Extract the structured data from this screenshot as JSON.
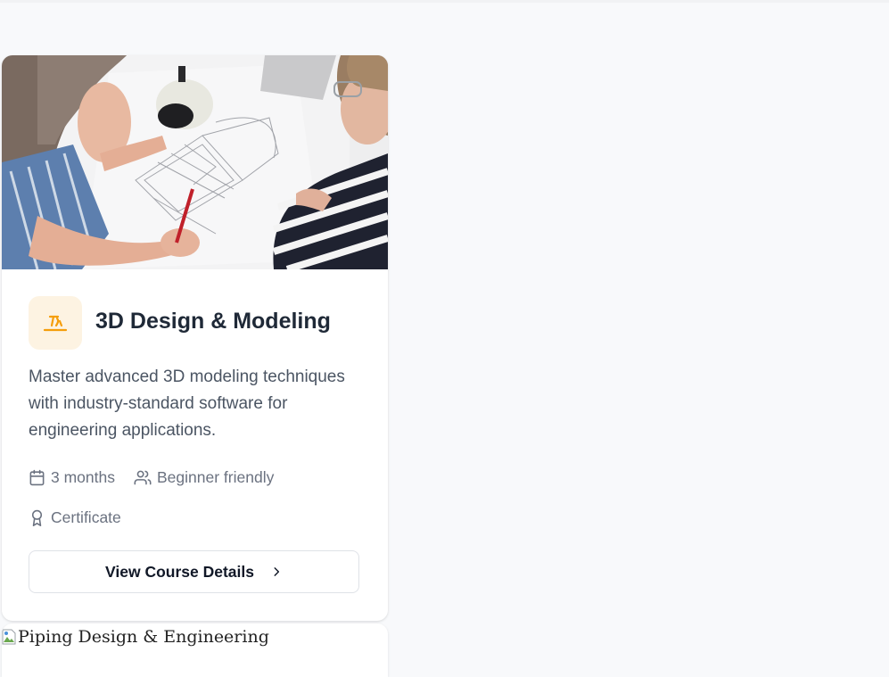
{
  "course_card": {
    "image_alt": "3D Design & Modeling",
    "icon": "3d-design-icon",
    "title": "3D Design & Modeling",
    "description": "Master advanced 3D modeling techniques with industry-standard software for engineering applications.",
    "duration": "3 months",
    "level": "Beginner friendly",
    "certificate": "Certificate",
    "button_label": "View Course Details",
    "accent_color": "#f59e0b",
    "icon_bg_color": "#fdf3e2"
  },
  "next_card": {
    "image_alt_text": "Piping Design & Engineering"
  }
}
